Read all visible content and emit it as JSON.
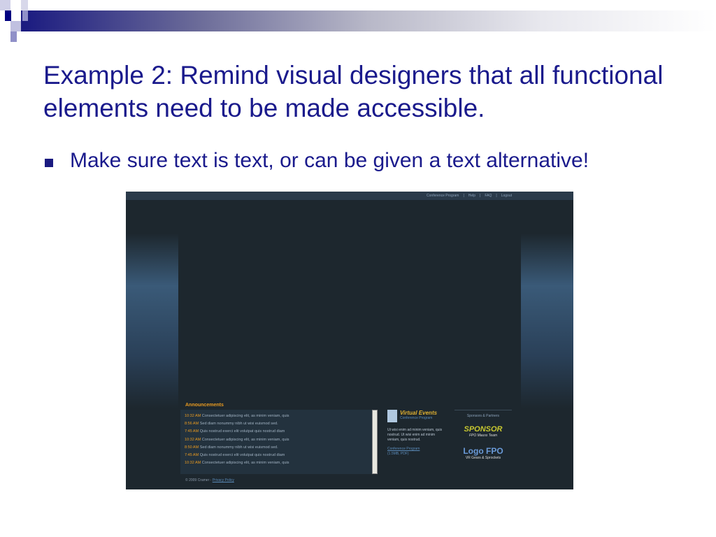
{
  "slide": {
    "title": "Example 2: Remind visual designers that all functional elements need to be made accessible.",
    "bullet": "Make sure text is text, or can be given a text alternative!"
  },
  "screenshot": {
    "nav": [
      "Conference Program",
      "Help",
      "FAQ",
      "Logout"
    ],
    "announcements_heading": "Announcements",
    "announcements": [
      {
        "time": "10:32 AM",
        "text": "Consectetuer adipiscing elit, as minim veniam, quis"
      },
      {
        "time": "8:56 AM",
        "text": "Sed diam nonummy nibh ut wisi euismod sed."
      },
      {
        "time": "7:45 AM",
        "text": "Quis nostrud exerci elit volutpat quis nostrud diam"
      },
      {
        "time": "10:32 AM",
        "text": "Consectetuer adipiscing elit, as minim veniam, quis"
      },
      {
        "time": "8:50 AM",
        "text": "Sed diam nonummy nibh ut wisi euismod sed."
      },
      {
        "time": "7:45 AM",
        "text": "Quis nostrud exerci elit volutpat quis nostrud diam"
      },
      {
        "time": "10:32 AM",
        "text": "Consectetuer adipiscing elit, as minim veniam, quis"
      }
    ],
    "virtual_events": {
      "title": "Virtual Events",
      "subtitle": "Conference Program",
      "body": "Ut wisi enim ad minim veniam, quis nostrud. Ut wisi enim ad minim veniam, quis nostrud.",
      "link": "Conference Program",
      "link_meta": "(1.5MB, PDF)"
    },
    "sponsors": {
      "heading": "Sponsors & Partners",
      "sponsor": "SPONSOR",
      "sponsor_sub": "FPO Mauss Team",
      "logo": "Logo FPO",
      "logo_sub": "VR Gears & Sprockets"
    },
    "footer": {
      "copyright": "© 2009 Cramer -",
      "privacy": "Privacy Policy"
    }
  }
}
